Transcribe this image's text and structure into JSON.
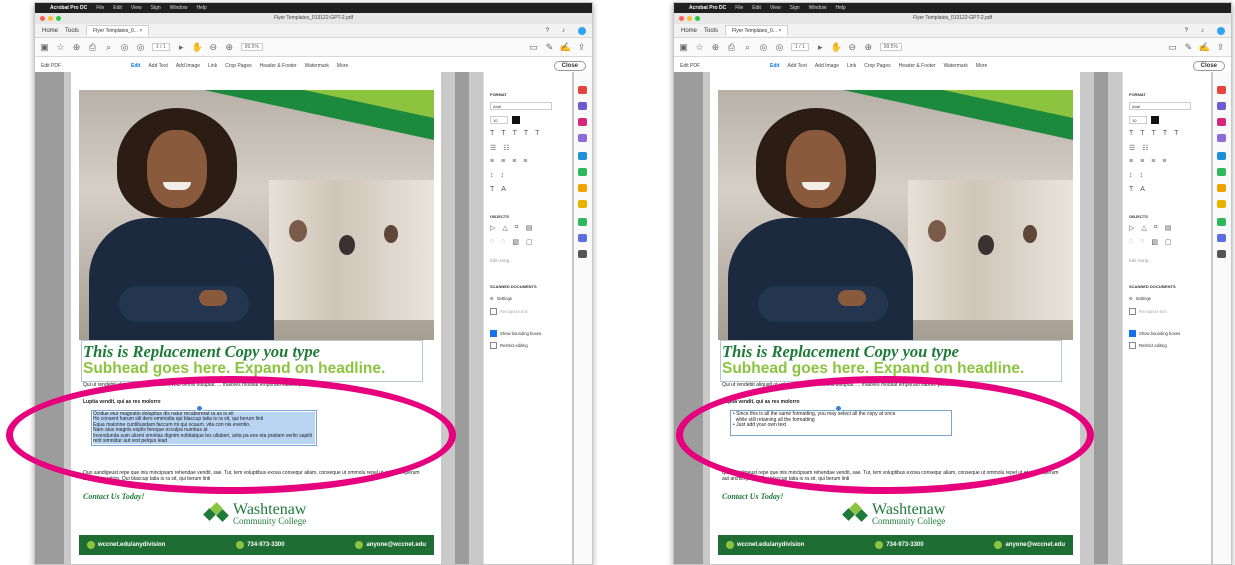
{
  "colors": {
    "accent": "#e6007e",
    "brand_green": "#1f7a3a",
    "lime": "#8cc43f",
    "footer_green": "#1e6e34",
    "selection": "#b9d4f2",
    "acrobat_blue": "#1473e6"
  },
  "menubar": {
    "app": "Acrobat Pro DC",
    "items": [
      "File",
      "Edit",
      "View",
      "Sign",
      "Window",
      "Help"
    ]
  },
  "window_title": "Flyer Templates_013122-GPT-2.pdf",
  "tabs": {
    "home": "Home",
    "tools": "Tools",
    "doc": "Flyer Templates_0... ×"
  },
  "toolbar": {
    "page_counter": "1 / 1",
    "zoom": "99.5%"
  },
  "editbar": {
    "mode": "Edit PDF",
    "tools": [
      "Edit",
      "Add Text",
      "Add Image",
      "Link",
      "Crop Pages",
      "Header & Footer",
      "Watermark",
      "More"
    ],
    "close": "Close"
  },
  "flyer": {
    "headline": "This is Replacement Copy you type",
    "subhead": "Subhead goes here. Expand on headline.",
    "intro": "Qui ut rendebit aliquatl ut volenemuam, volo omnis doluptat. ... maiores moditat emporato liabore perum.",
    "lead": "Luptia vendit, qui as res molorro",
    "bullets_before": [
      "Ocidue eiur magnatio doluptius dis natur recaborerat ra as is eit",
      "Ho consent harum sili dero ommodia qui blaccup tatia is ra sit, qui berum linti",
      "Equa maionne cuntibusdam faccum mi qui ocaum, vita con nis eventio.\nNam alus magnis explis fereque occulpa numbus at",
      "Invendunda sum ulismi omnitas dignim nobitatque les ullaberi, arita pa eos eta pratiam verlio sapiiti rerit simnidur aut rest pelquo lead"
    ],
    "bullets_after": [
      "• Since this is all the same formatting, you may select all the copy at once",
      "  while still retaining all the formatting",
      "• Just add your own text"
    ],
    "para": "Quo sandigeust repe que inis mincipsam rehendae vendit, sae. Tur, tem voluptibus excea consequr aliam, conseque ut ommolu repel ut et omnimperum aut archici pition. Qui blaccup tatia is ra sit, qui berum linti",
    "contact": "Contact Us Today!",
    "logo_line1": "Washtenaw",
    "logo_line2": "Community College",
    "footer": {
      "web": "wccnet.edu/anydivision",
      "phone": "734-973-3300",
      "email": "anyone@wccnet.edu"
    }
  },
  "panel": {
    "format": "FORMAT",
    "font": "Arial",
    "size": "10",
    "objects": "OBJECTS",
    "edit_using": "Edit Using...",
    "scanned": "SCANNED DOCUMENTS",
    "settings": "Settings",
    "recognize": "Recognize text",
    "show_boxes": "Show bounding boxes",
    "restrict": "Restrict editing"
  }
}
